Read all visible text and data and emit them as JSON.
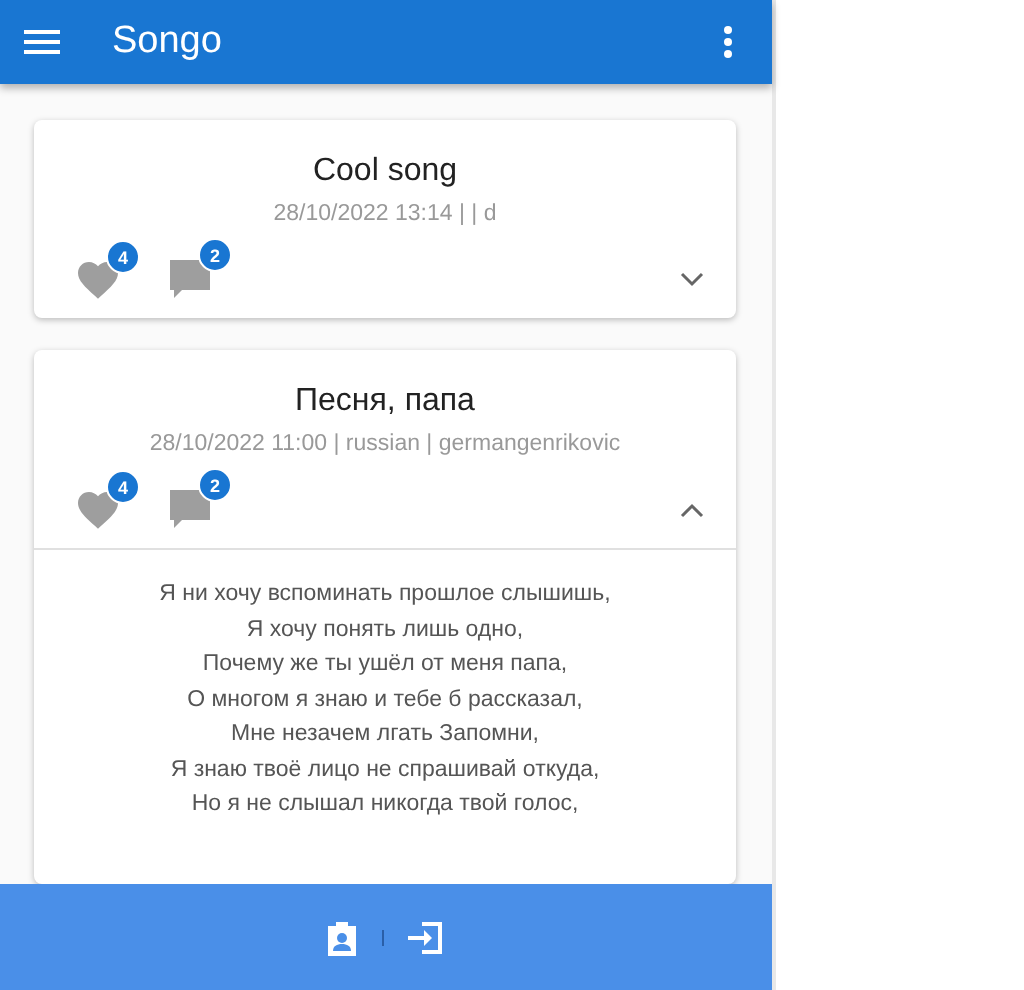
{
  "app_bar": {
    "title": "Songo"
  },
  "songs": [
    {
      "title": "Cool song",
      "meta": "28/10/2022 13:14 | | d",
      "likes": "4",
      "comments": "2",
      "expanded": false
    },
    {
      "title": "Песня, папа",
      "meta": "28/10/2022 11:00 | russian | germangenrikovic",
      "likes": "4",
      "comments": "2",
      "expanded": true,
      "lyrics": [
        "Я ни хочу вспоминать прошлое слышишь,",
        "Я хочу понять лишь одно,",
        "Почему же ты ушёл от меня папа,",
        "О многом я знаю и тебе б рассказал,",
        "Мне незачем лгать Запомни,",
        "Я знаю твоё лицо не спрашивай откуда,",
        "Но я не слышал никогда твой голос,"
      ]
    }
  ]
}
